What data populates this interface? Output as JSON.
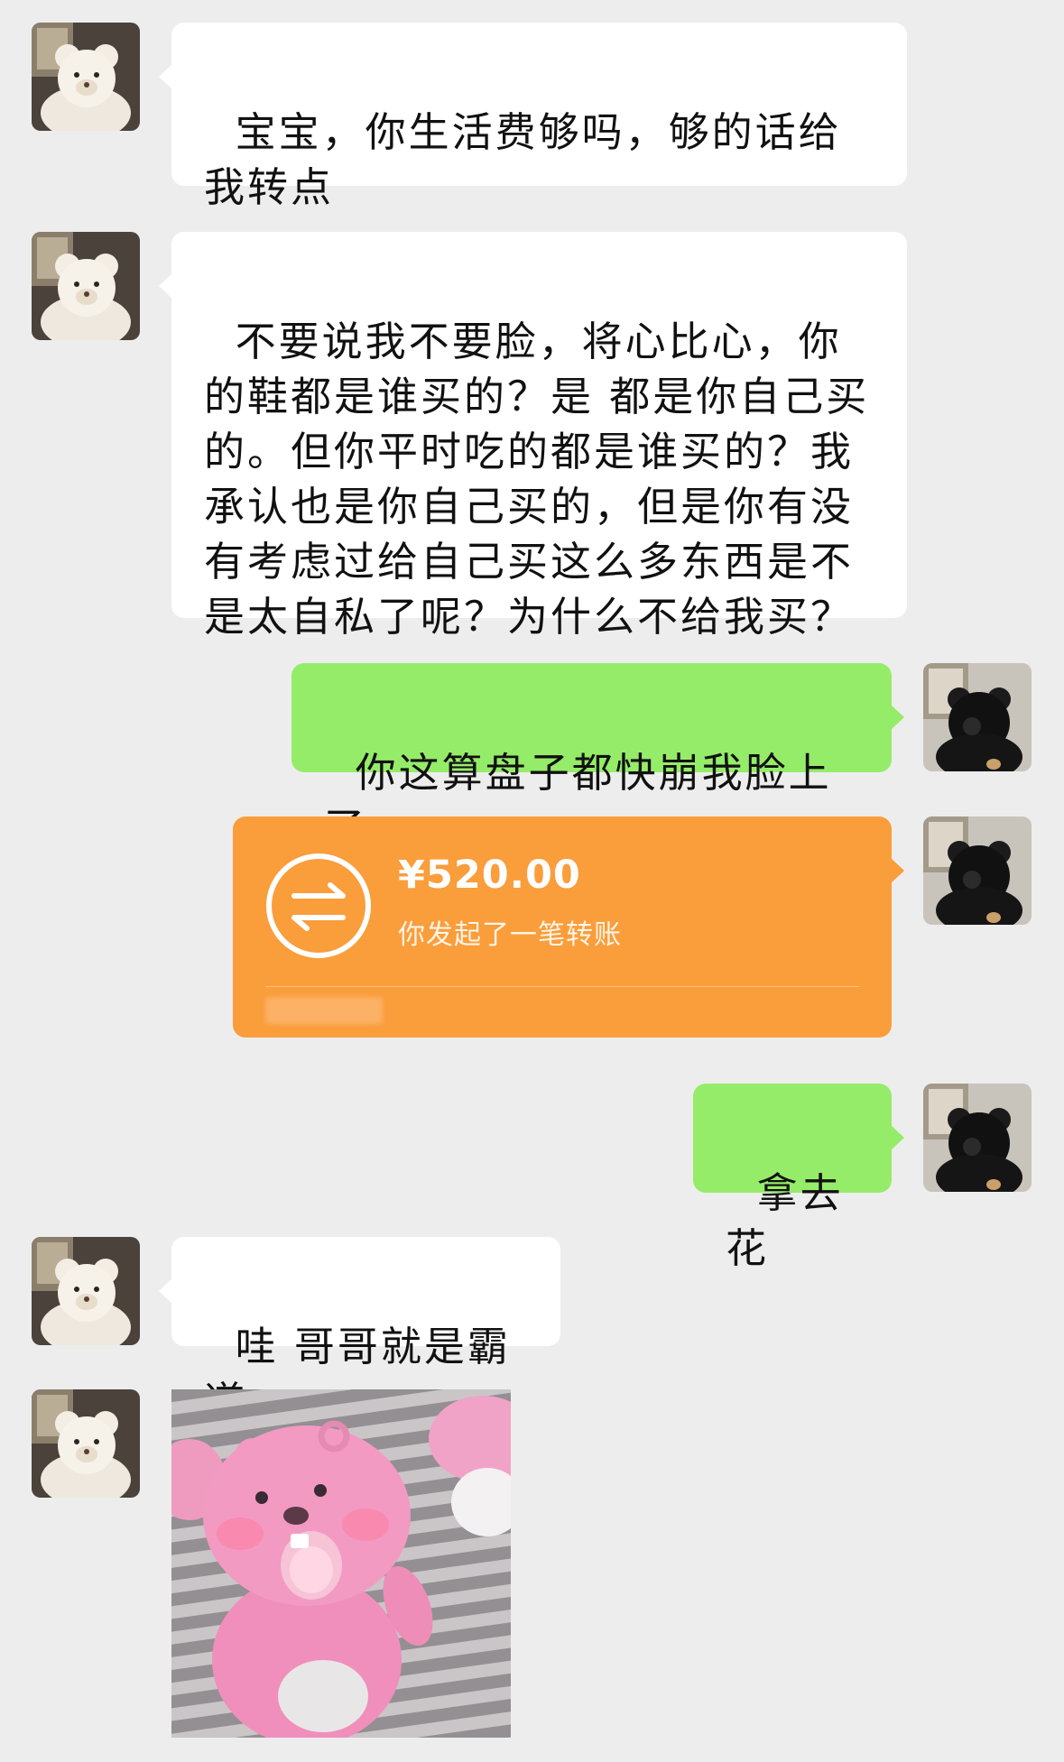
{
  "messages": {
    "m1": "宝宝，你生活费够吗，够的话给我转点",
    "m2": "不要说我不要脸，将心比心，你的鞋都是谁买的？是 都是你自己买的。但你平时吃的都是谁买的？我承认也是你自己买的，但是你有没有考虑过给自己买这么多东西是不是太自私了呢？为什么不给我买？",
    "m3": "你这算盘子都快崩我脸上了",
    "m5": "拿去花",
    "m6": "哇 哥哥就是霸道"
  },
  "transfer": {
    "amount": "¥520.00",
    "description": "你发起了一笔转账",
    "color": "#fa9d3b"
  },
  "colors": {
    "background": "#ededed",
    "incoming_bubble": "#ffffff",
    "outgoing_bubble": "#95ec69"
  },
  "icons": {
    "incoming_avatar": "white-bear-avatar",
    "outgoing_avatar": "black-bear-avatar",
    "transfer_icon": "transfer-arrows-icon",
    "sticker": "pink-beaver-sticker"
  }
}
